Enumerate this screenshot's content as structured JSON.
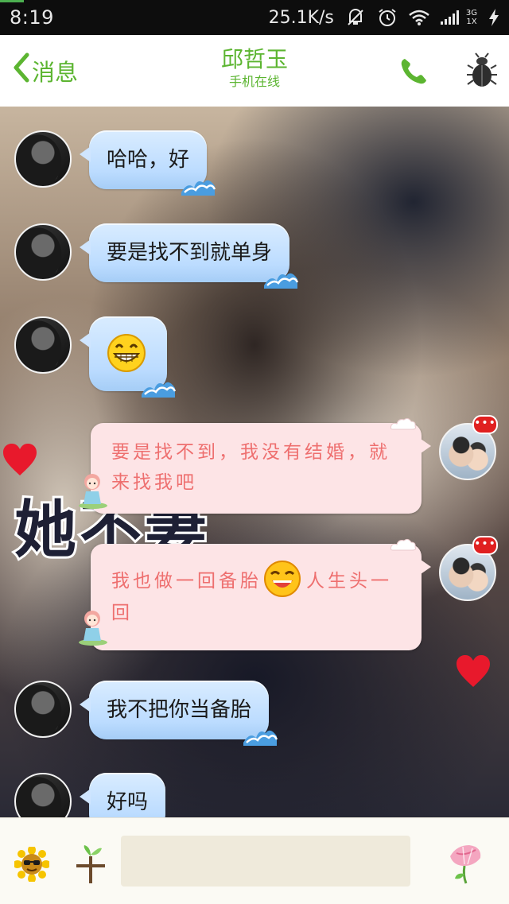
{
  "status_bar": {
    "time": "8:19",
    "speed": "25.1K/s",
    "net_top": "3G",
    "net_bottom": "1X",
    "icons": [
      "mute-vibrate-icon",
      "alarm-icon",
      "wifi-icon",
      "signal-icon",
      "charging-icon"
    ]
  },
  "header": {
    "back_label": "消息",
    "contact_name": "邱哲玉",
    "contact_status": "手机在线",
    "icons": [
      "chevron-left-icon",
      "phone-icon",
      "beetle-icon"
    ]
  },
  "background": {
    "overlay_text": "她不妻"
  },
  "messages": [
    {
      "sender": "her",
      "type": "text",
      "text": "哈哈，好"
    },
    {
      "sender": "her",
      "type": "text",
      "text": "要是找不到就单身"
    },
    {
      "sender": "her",
      "type": "emoji",
      "emoji": "grin-emoji"
    },
    {
      "sender": "me",
      "type": "text",
      "text": "要是找不到，我没有结婚，就来找我吧",
      "badge": "•••"
    },
    {
      "sender": "me",
      "type": "text",
      "text_before": "我也做一回备胎",
      "emoji": "laugh-emoji",
      "text_after": "人生头一回",
      "badge": "•••"
    },
    {
      "sender": "her",
      "type": "text",
      "text": "我不把你当备胎"
    },
    {
      "sender": "her",
      "type": "text",
      "text": "好吗"
    }
  ],
  "input_bar": {
    "placeholder": "",
    "value": "",
    "icons": [
      "sunflower-emoji-icon",
      "sprout-icon",
      "morning-glory-icon"
    ]
  },
  "colors": {
    "accent_green": "#5cb531",
    "bubble_blue": "#bcdcff",
    "bubble_pink": "#fde4e6",
    "pink_text": "#ee6f6f",
    "badge_red": "#e02020"
  }
}
